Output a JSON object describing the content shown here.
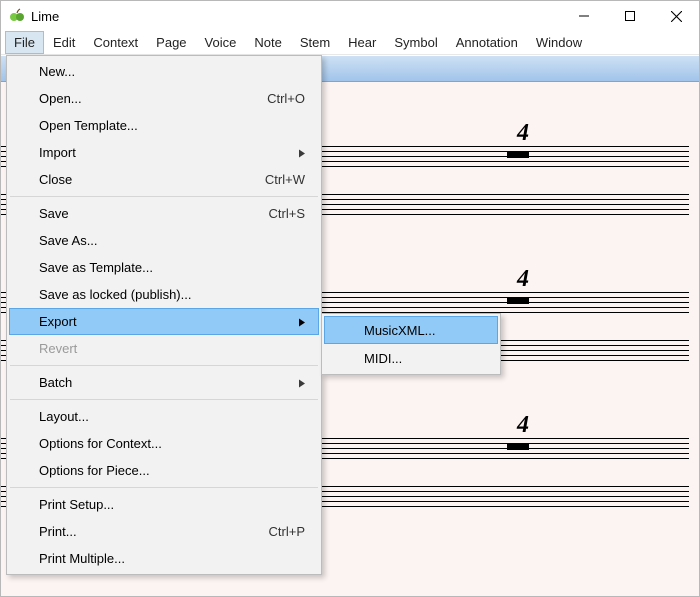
{
  "app": {
    "title": "Lime"
  },
  "menubar": {
    "items": [
      {
        "label": "File",
        "open": true
      },
      {
        "label": "Edit"
      },
      {
        "label": "Context"
      },
      {
        "label": "Page"
      },
      {
        "label": "Voice"
      },
      {
        "label": "Note"
      },
      {
        "label": "Stem"
      },
      {
        "label": "Hear"
      },
      {
        "label": "Symbol"
      },
      {
        "label": "Annotation"
      },
      {
        "label": "Window"
      }
    ]
  },
  "file_menu": {
    "new": "New...",
    "open": "Open...",
    "open_shortcut": "Ctrl+O",
    "open_template": "Open Template...",
    "import": "Import",
    "close": "Close",
    "close_shortcut": "Ctrl+W",
    "save": "Save",
    "save_shortcut": "Ctrl+S",
    "save_as": "Save As...",
    "save_as_template": "Save as Template...",
    "save_as_locked": "Save as locked (publish)...",
    "export": "Export",
    "revert": "Revert",
    "batch": "Batch",
    "layout": "Layout...",
    "options_context": "Options for Context...",
    "options_piece": "Options for Piece...",
    "print_setup": "Print Setup...",
    "print": "Print...",
    "print_shortcut": "Ctrl+P",
    "print_multiple": "Print Multiple..."
  },
  "export_submenu": {
    "musicxml": "MusicXML...",
    "midi": "MIDI..."
  },
  "score": {
    "time_signature": "4"
  }
}
